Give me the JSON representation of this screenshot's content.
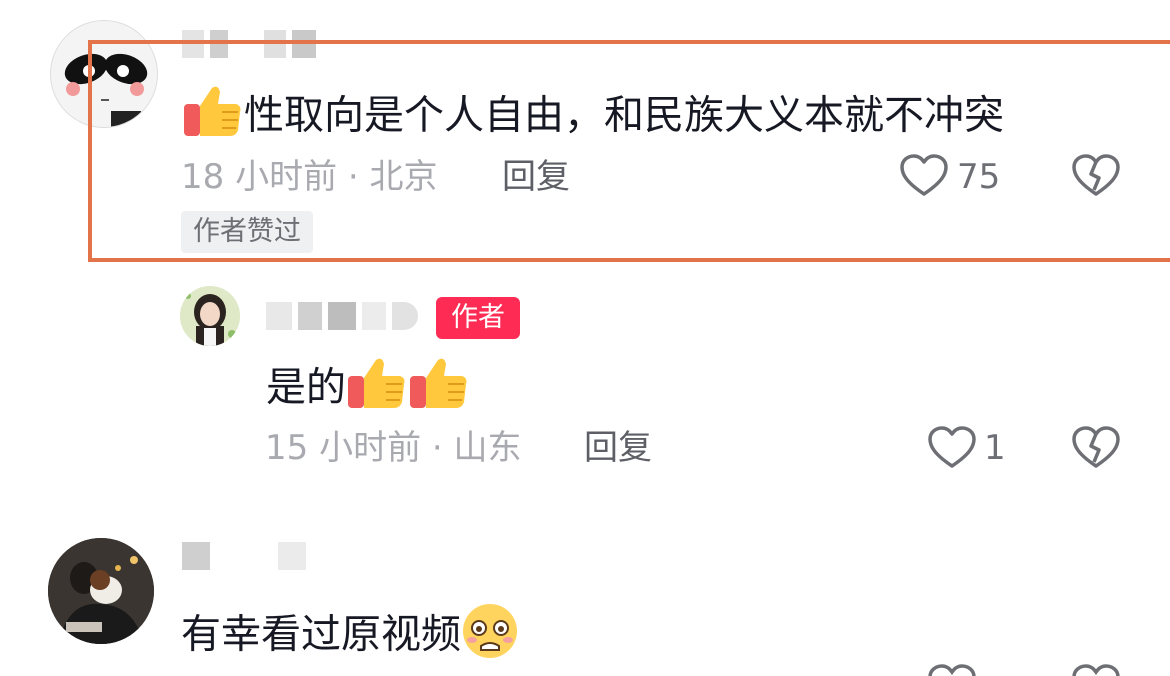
{
  "comments": [
    {
      "text": "性取向是个人自由，和民族大义本就不冲突",
      "meta": "18 小时前 · 北京",
      "reply": "回复",
      "likes": "75",
      "tag": "作者赞过",
      "highlighted": true
    },
    {
      "text": "是的",
      "meta": "15 小时前 · 山东",
      "reply": "回复",
      "likes": "1",
      "badge": "作者"
    },
    {
      "text": "有幸看过原视频"
    }
  ],
  "icons": {
    "like": "heart-outline-icon",
    "dislike": "broken-heart-icon",
    "thumbs_up": "thumbs-up-emoji",
    "pleading": "pleading-face-emoji"
  },
  "colors": {
    "highlight_border": "#e3744a",
    "author_badge": "#fe2c55",
    "meta_text": "#a9aab0"
  }
}
